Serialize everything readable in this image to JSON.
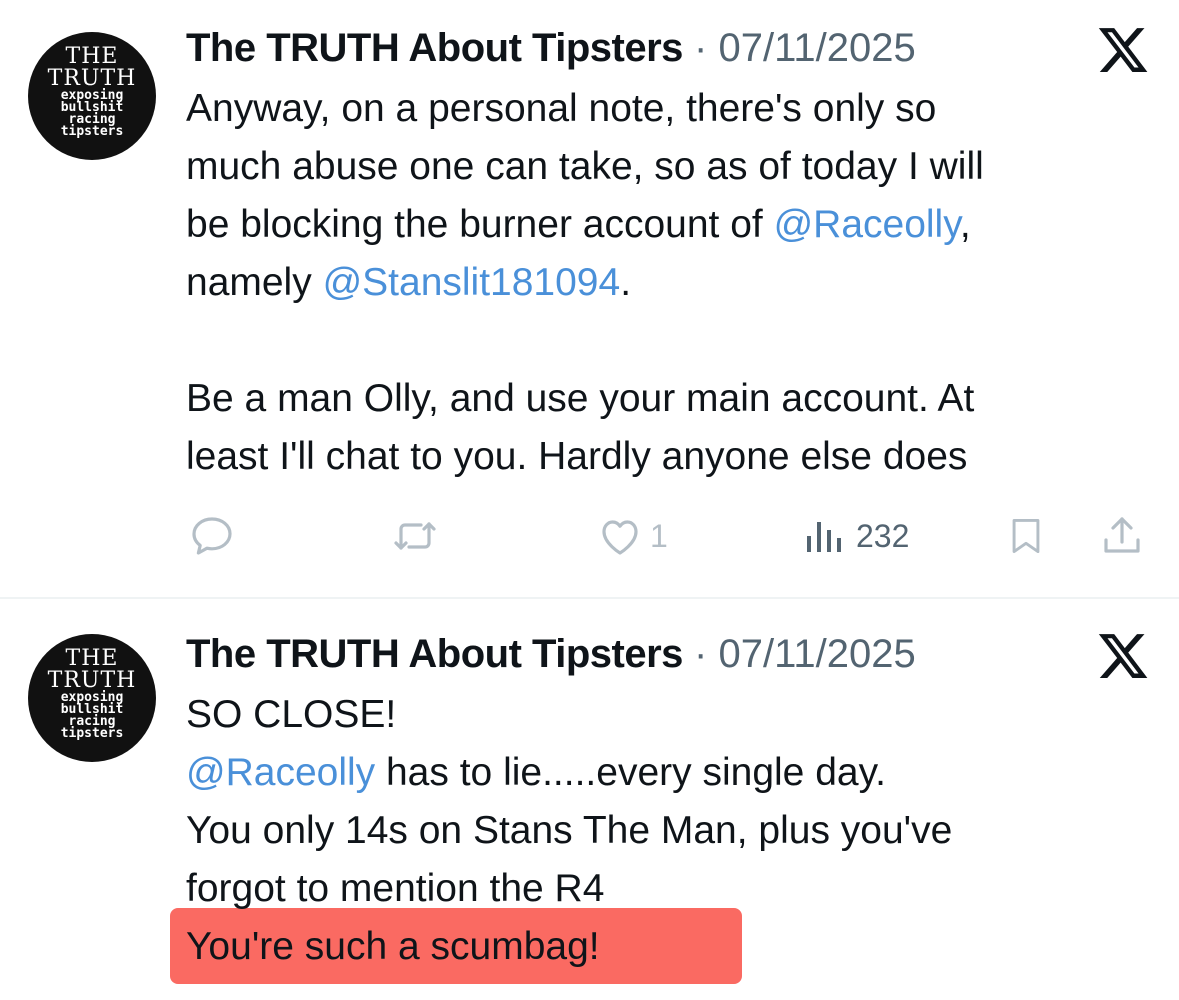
{
  "tweets": [
    {
      "avatar": {
        "line1": "THE",
        "line2": "TRUTH",
        "line3": "exposing",
        "line4": "bullshit",
        "line5": "racing",
        "line6": "tipsters"
      },
      "author": "The TRUTH About Tipsters",
      "separator": "·",
      "date": "07/11/2025",
      "body": {
        "l1": "Anyway, on a personal note, there's only so",
        "l2": "much abuse one can take, so as of today I will",
        "l3_pre": "be blocking the burner account of ",
        "l3_mention": "@Raceolly",
        "l3_post": ",",
        "l4_pre": "namely ",
        "l4_mention": "@Stanslit181094",
        "l4_post": ".",
        "l5": "Be a man Olly, and use your main account. At",
        "l6": "least I'll chat to you. Hardly anyone else does"
      },
      "actions": {
        "likes": "1",
        "views": "232"
      }
    },
    {
      "avatar": {
        "line1": "THE",
        "line2": "TRUTH",
        "line3": "exposing",
        "line4": "bullshit",
        "line5": "racing",
        "line6": "tipsters"
      },
      "author": "The TRUTH About Tipsters",
      "separator": "·",
      "date": "07/11/2025",
      "body": {
        "l1": "SO CLOSE!",
        "l2_mention": "@Raceolly",
        "l2_post": " has to lie.....every single day.",
        "l3": "You only 14s on Stans The Man, plus you've",
        "l4": "forgot to mention the R4",
        "l5": "You're such a scumbag!"
      }
    }
  ],
  "colors": {
    "mention": "#4a90d9",
    "highlight": "#fa6a62",
    "muted": "#536471",
    "action_icon": "#b4bec6"
  },
  "icons": [
    "x-logo-icon",
    "reply-icon",
    "retweet-icon",
    "like-icon",
    "views-icon",
    "bookmark-icon",
    "share-icon"
  ]
}
